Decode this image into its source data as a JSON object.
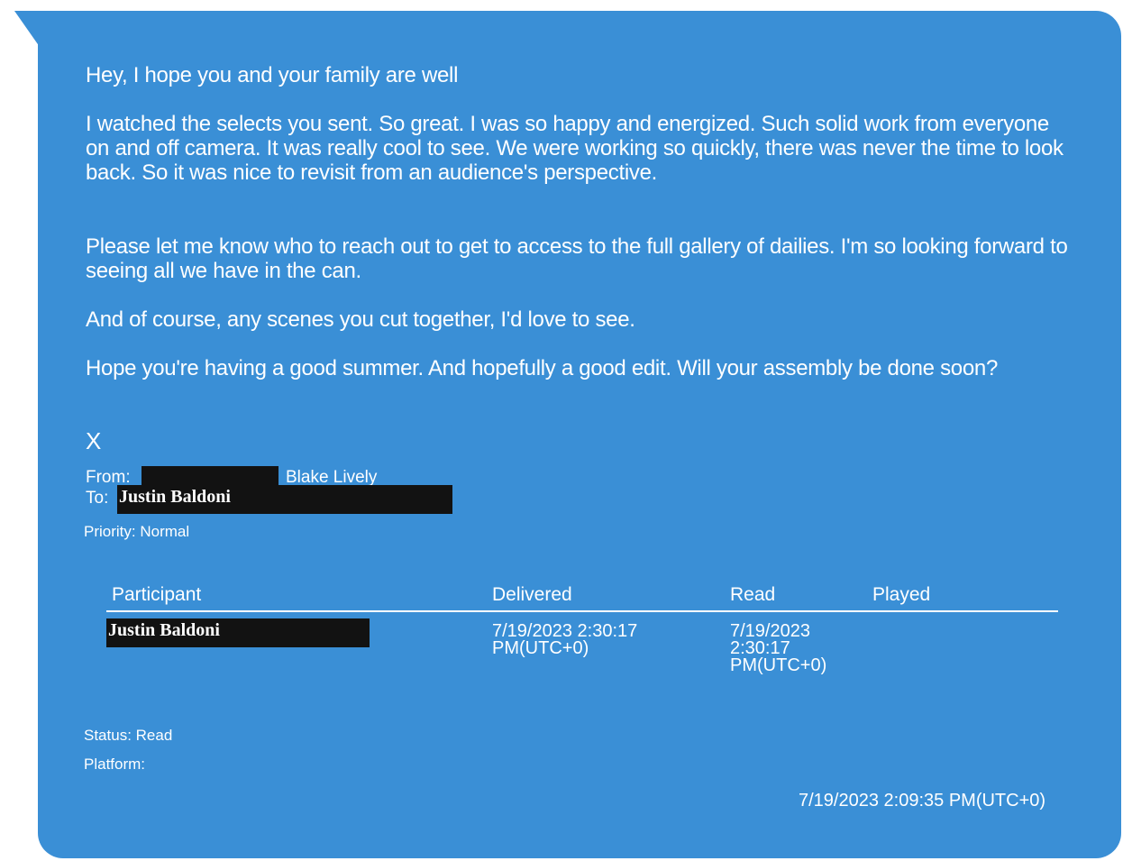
{
  "message": {
    "greeting": "Hey, I hope you and your family are well",
    "paragraph1": "I watched the selects you sent. So great. I was so happy and energized. Such solid work from everyone on and off camera. It was really cool to see. We were working so quickly, there was never the time to look back. So it was nice to revisit from an audience's perspective.",
    "paragraph2": "Please let me know who to reach out to get to access to the full gallery of dailies. I'm so looking forward to seeing all we have in the can.",
    "paragraph3": "And of course, any scenes you cut together, I'd love to see.",
    "paragraph4": "Hope you're having a good summer. And hopefully a good edit. Will your assembly be done soon?",
    "signoff": "X"
  },
  "header": {
    "from_label": "From:",
    "from_name": "Blake Lively",
    "to_label": "To:",
    "to_name": "Justin Baldoni",
    "priority": "Priority: Normal"
  },
  "receipt_table": {
    "columns": [
      "Participant",
      "Delivered",
      "Read",
      "Played"
    ],
    "rows": [
      {
        "participant": "Justin Baldoni",
        "delivered": "7/19/2023 2:30:17\nPM(UTC+0)",
        "read": "7/19/2023\n2:30:17\nPM(UTC+0)",
        "played": ""
      }
    ]
  },
  "footer": {
    "status": "Status: Read",
    "platform": "Platform:",
    "timestamp": "7/19/2023 2:09:35 PM(UTC+0)"
  },
  "colors": {
    "bubble": "#3a8fd6",
    "redaction": "#121212",
    "text": "#ffffff"
  }
}
